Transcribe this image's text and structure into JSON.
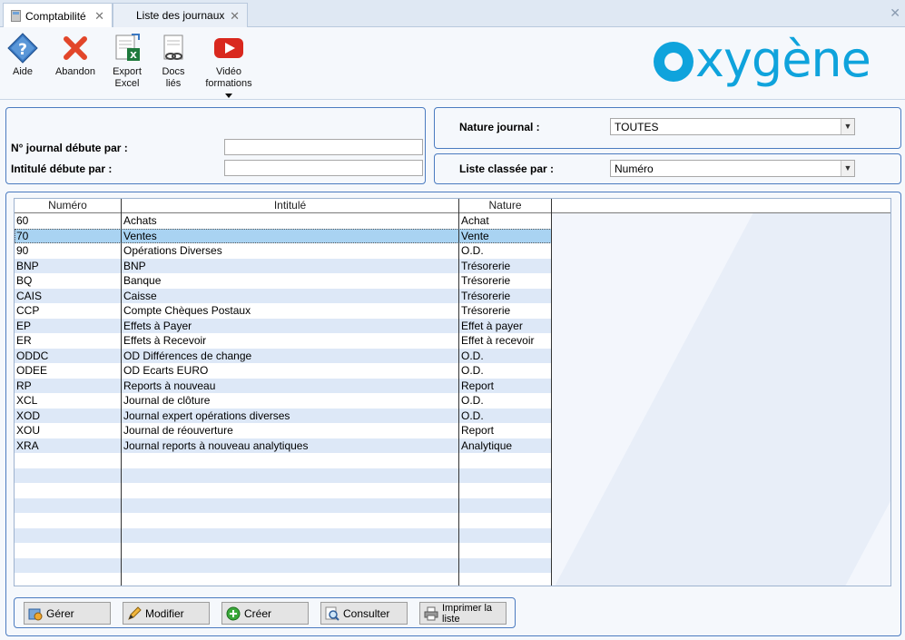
{
  "tabs": [
    {
      "label": "Comptabilité",
      "active": true
    },
    {
      "label": "Liste des journaux",
      "active": false
    }
  ],
  "toolbar": {
    "aide": "Aide",
    "abandon": "Abandon",
    "export_line1": "Export",
    "export_line2": "Excel",
    "docs_line1": "Docs",
    "docs_line2": "liés",
    "video_line1": "Vidéo",
    "video_line2": "formations"
  },
  "logo_text": "xygène",
  "filters": {
    "num_label": "N° journal débute par :",
    "num_value": "",
    "intitule_label": "Intitulé débute par :",
    "intitule_value": "",
    "nature_label": "Nature journal :",
    "nature_value": "TOUTES",
    "sort_label": "Liste classée par :",
    "sort_value": "Numéro"
  },
  "grid": {
    "columns": [
      "Numéro",
      "Intitulé",
      "Nature"
    ],
    "rows": [
      {
        "num": "60",
        "intitule": "Achats",
        "nature": "Achat"
      },
      {
        "num": "70",
        "intitule": "Ventes",
        "nature": "Vente",
        "selected": true
      },
      {
        "num": "90",
        "intitule": "Opérations Diverses",
        "nature": "O.D."
      },
      {
        "num": "BNP",
        "intitule": "BNP",
        "nature": "Trésorerie"
      },
      {
        "num": "BQ",
        "intitule": "Banque",
        "nature": "Trésorerie"
      },
      {
        "num": "CAIS",
        "intitule": "Caisse",
        "nature": "Trésorerie"
      },
      {
        "num": "CCP",
        "intitule": "Compte Chèques Postaux",
        "nature": "Trésorerie"
      },
      {
        "num": "EP",
        "intitule": "Effets à Payer",
        "nature": "Effet à payer"
      },
      {
        "num": "ER",
        "intitule": "Effets à Recevoir",
        "nature": "Effet à recevoir"
      },
      {
        "num": "ODDC",
        "intitule": "OD Différences de change",
        "nature": "O.D."
      },
      {
        "num": "ODEE",
        "intitule": "OD Ecarts EURO",
        "nature": "O.D."
      },
      {
        "num": "RP",
        "intitule": "Reports à nouveau",
        "nature": "Report"
      },
      {
        "num": "XCL",
        "intitule": "Journal de clôture",
        "nature": "O.D."
      },
      {
        "num": "XOD",
        "intitule": "Journal expert opérations diverses",
        "nature": "O.D."
      },
      {
        "num": "XOU",
        "intitule": "Journal de réouverture",
        "nature": "Report"
      },
      {
        "num": "XRA",
        "intitule": "Journal reports à nouveau analytiques",
        "nature": "Analytique"
      }
    ]
  },
  "buttons": {
    "gerer": "Gérer",
    "modifier": "Modifier",
    "creer": "Créer",
    "consulter": "Consulter",
    "imprimer": "Imprimer la liste"
  },
  "colors": {
    "accent": "#0fa3dc",
    "panel_border": "#4b7bc0",
    "selected_row": "#a9d3f2",
    "alt_row": "#dde8f7"
  }
}
